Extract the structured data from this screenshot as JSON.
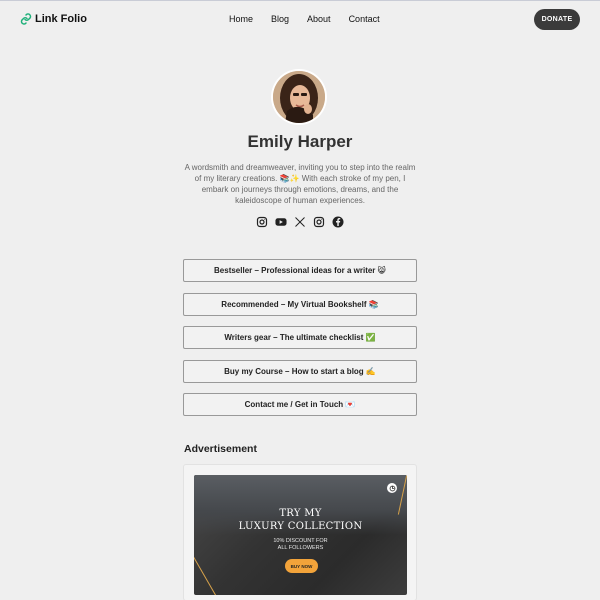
{
  "header": {
    "brand": "Link Folio",
    "nav": [
      "Home",
      "Blog",
      "About",
      "Contact"
    ],
    "donate_label": "DONATE"
  },
  "profile": {
    "name": "Emily Harper",
    "bio": "A wordsmith and dreamweaver, inviting you to step into the realm of my literary creations. 📚✨ With each stroke of my pen, I embark on journeys through emotions, dreams, and the kaleidoscope of human experiences.",
    "socials": [
      "instagram-icon",
      "youtube-icon",
      "x-icon",
      "instagram-icon",
      "facebook-icon"
    ]
  },
  "links": [
    "Bestseller – Professional ideas for a writer 😸",
    "Recommended – My Virtual Bookshelf 📚",
    "Writers gear – The ultimate checklist ✅",
    "Buy my Course – How to start a blog ✍️",
    "Contact me / Get in Touch 💌"
  ],
  "advertisement": {
    "title": "Advertisement",
    "headline_1": "TRY MY",
    "headline_2": "LUXURY COLLECTION",
    "sub_1": "10% DISCOUNT FOR",
    "sub_2": "ALL FOLLOWERS",
    "button": "BUY NOW"
  },
  "colors": {
    "background": "#efefef",
    "donate_bg": "#3b3b3b",
    "logo_accent": "#1fb07a",
    "ad_button": "#f2a33a"
  }
}
